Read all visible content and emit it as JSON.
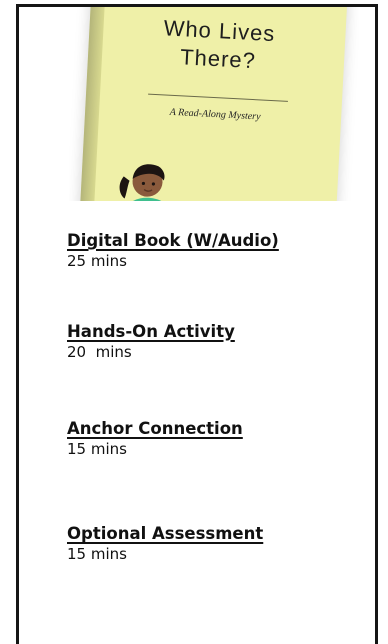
{
  "book_cover": {
    "title": "Who Lives\nThere?",
    "subtitle": "A Read-Along Mystery"
  },
  "activities": [
    {
      "title": "Digital Book (W/Audio)",
      "duration": "25 mins"
    },
    {
      "title": "Hands-On Activity",
      "duration": "20  mins"
    },
    {
      "title": "Anchor Connection",
      "duration": "15 mins"
    },
    {
      "title": "Optional Assessment",
      "duration": "15 mins"
    }
  ]
}
